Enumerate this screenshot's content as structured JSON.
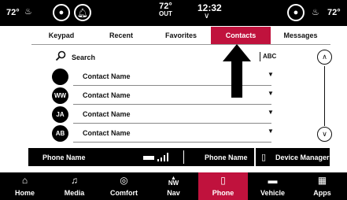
{
  "status_bar": {
    "left_temp": "72°",
    "outside_temp": "72°",
    "outside_label": "OUT",
    "time": "12:32",
    "right_temp": "72°"
  },
  "tabs": [
    {
      "label": "Keypad",
      "active": false
    },
    {
      "label": "Recent",
      "active": false
    },
    {
      "label": "Favorites",
      "active": false
    },
    {
      "label": "Contacts",
      "active": true
    },
    {
      "label": "Messages",
      "active": false
    }
  ],
  "search": {
    "label": "Search"
  },
  "alpha_index": {
    "label": "ABC"
  },
  "contacts": [
    {
      "initials": "",
      "name": "Contact Name"
    },
    {
      "initials": "WW",
      "name": "Contact Name"
    },
    {
      "initials": "JA",
      "name": "Contact Name"
    },
    {
      "initials": "AB",
      "name": "Contact Name"
    }
  ],
  "phone_bar": {
    "left_phone_name": "Phone Name",
    "right_phone_name": "Phone Name",
    "device_manager_label": "Device Manager"
  },
  "nav": [
    {
      "label": "Home",
      "icon": "home-icon",
      "active": false
    },
    {
      "label": "Media",
      "icon": "music-note-icon",
      "active": false
    },
    {
      "label": "Comfort",
      "icon": "seat-comfort-icon",
      "active": false
    },
    {
      "label": "Nav",
      "icon": "compass-icon",
      "heading": "NW",
      "active": false
    },
    {
      "label": "Phone",
      "icon": "phone-icon",
      "active": true
    },
    {
      "label": "Vehicle",
      "icon": "vehicle-icon",
      "active": false
    },
    {
      "label": "Apps",
      "icon": "apps-grid-icon",
      "active": false
    }
  ],
  "colors": {
    "accent": "#c0123d",
    "bar": "#000000"
  }
}
